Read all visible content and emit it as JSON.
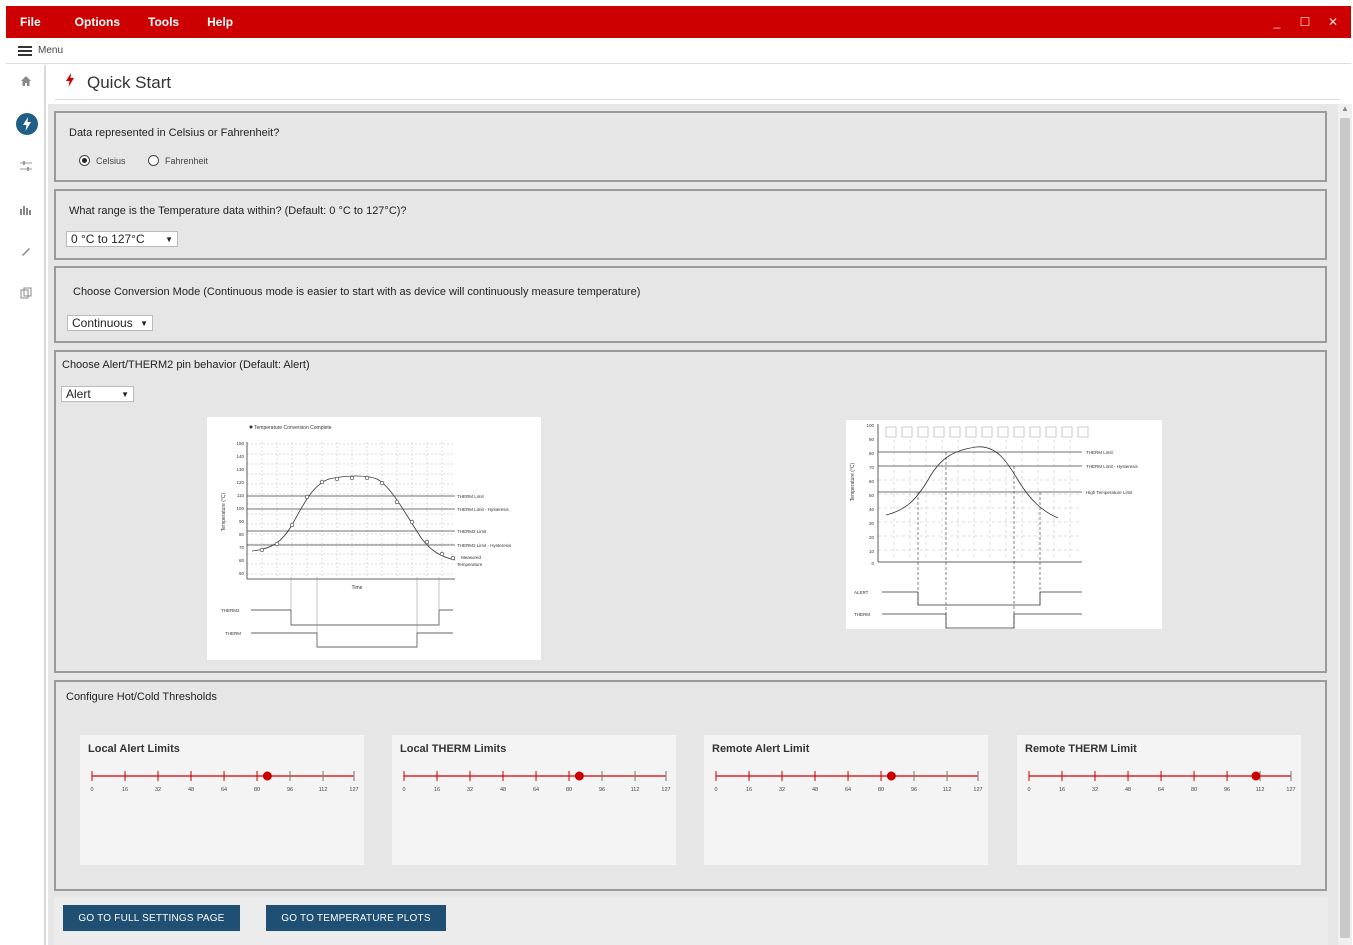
{
  "titlebar": {
    "menu": [
      "File",
      "Options",
      "Tools",
      "Help"
    ],
    "controls": [
      "_",
      "☐",
      "✕"
    ]
  },
  "menubar": {
    "label": "Menu"
  },
  "nav": {
    "icons": [
      "home-icon",
      "bolt-icon",
      "sliders-icon",
      "bar-chart-icon",
      "pencil-icon",
      "copy-icon"
    ]
  },
  "page": {
    "title": "Quick Start"
  },
  "units": {
    "question": "Data represented in Celsius or Fahrenheit?",
    "options": [
      "Celsius",
      "Fahrenheit"
    ],
    "selected": "Celsius"
  },
  "range": {
    "question": "What range is the Temperature data within? (Default: 0 °C to 127°C)?",
    "value": "0 °C to 127°C"
  },
  "conversion": {
    "question": "Choose Conversion Mode (Continuous mode is easier to start with as device will continuously measure temperature)",
    "value": "Continuous"
  },
  "alert": {
    "question": "Choose Alert/THERM2 pin behavior (Default: Alert)",
    "value": "Alert",
    "diagram1": {
      "legend": "Temperature Conversion Complete",
      "ylabel": "Temperature (°C)",
      "xlabel": "Time",
      "yticks": [
        "150",
        "140",
        "130",
        "120",
        "110",
        "100",
        "90",
        "80",
        "70",
        "60",
        "50"
      ],
      "labels": [
        "THERM Limit",
        "THERM Limit - Hysteresis",
        "THERM2 Limit",
        "THERM2 Limit - Hysteresis",
        "Measured",
        "Temperature"
      ],
      "signals": [
        "THERM2",
        "THERM"
      ]
    },
    "diagram2": {
      "ylabel": "Temperature (°C)",
      "yticks": [
        "100",
        "90",
        "80",
        "70",
        "60",
        "50",
        "40",
        "30",
        "20",
        "10",
        "0"
      ],
      "labels": [
        "THERM Limit",
        "THERM Limit - Hysteresis",
        "High Temperature Limit"
      ],
      "signals": [
        "ALERT",
        "THERM"
      ]
    }
  },
  "thresholds": {
    "title": "Configure Hot/Cold Thresholds",
    "ticks": [
      "0",
      "16",
      "32",
      "48",
      "64",
      "80",
      "96",
      "112",
      "127"
    ],
    "cards": [
      {
        "title": "Local Alert Limits",
        "value": 85
      },
      {
        "title": "Local THERM Limits",
        "value": 85
      },
      {
        "title": "Remote Alert Limit",
        "value": 85
      },
      {
        "title": "Remote THERM Limit",
        "value": 110
      }
    ]
  },
  "buttons": {
    "settings": "GO TO FULL SETTINGS PAGE",
    "plots": "GO TO TEMPERATURE PLOTS"
  },
  "colors": {
    "brand": "#cc0000",
    "button": "#1f4f73",
    "slider": "#cc0000"
  }
}
